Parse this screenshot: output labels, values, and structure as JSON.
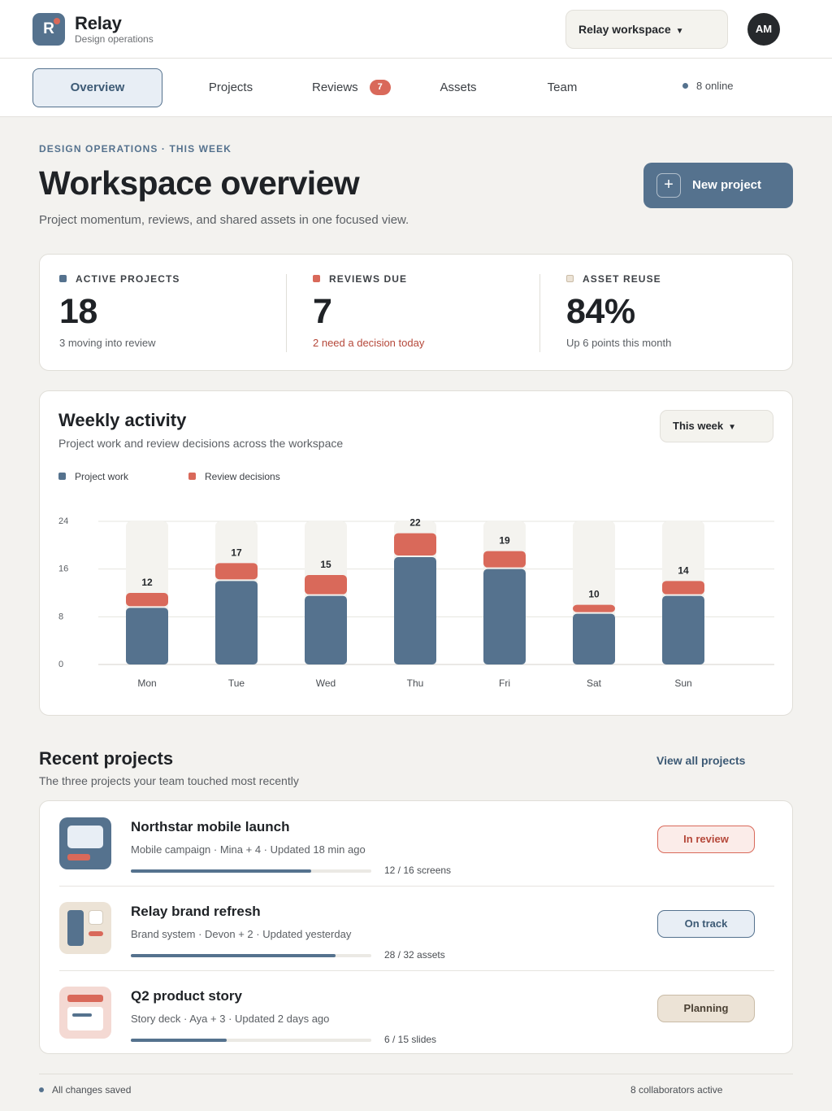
{
  "brand": {
    "name": "Relay",
    "subtitle": "Design operations",
    "logo_letter": "R"
  },
  "workspace_switcher": {
    "label": "Relay workspace",
    "caret": "▼"
  },
  "user": {
    "initials": "AM"
  },
  "nav": {
    "tabs": [
      {
        "label": "Overview",
        "active": true
      },
      {
        "label": "Projects"
      },
      {
        "label": "Reviews",
        "badge": "7"
      },
      {
        "label": "Assets"
      },
      {
        "label": "Team"
      }
    ],
    "online": "8 online"
  },
  "header": {
    "eyebrow": "DESIGN OPERATIONS · THIS WEEK",
    "title": "Workspace overview",
    "subtitle": "Project momentum, reviews, and shared assets in one focused view.",
    "new_button": {
      "icon": "+",
      "label": "New project"
    }
  },
  "stats": [
    {
      "label": "ACTIVE PROJECTS",
      "value": "18",
      "note": "3 moving into review",
      "color": "#55728e"
    },
    {
      "label": "REVIEWS DUE",
      "value": "7",
      "note": "2 need a decision today",
      "color": "#d9695a",
      "note_color": "#b5483a"
    },
    {
      "label": "ASSET REUSE",
      "value": "84%",
      "note": "Up 6 points this month",
      "color": "#ece3d6"
    }
  ],
  "activity": {
    "title": "Weekly activity",
    "subtitle": "Project work and review decisions across the workspace",
    "range_button": "This week",
    "range_caret": "▼"
  },
  "chart_data": {
    "type": "bar",
    "stacked": true,
    "categories": [
      "Mon",
      "Tue",
      "Wed",
      "Thu",
      "Fri",
      "Sat",
      "Sun"
    ],
    "series": [
      {
        "name": "Project work",
        "color": "#55728e",
        "values": [
          9.5,
          14,
          11.5,
          18,
          16,
          8.5,
          11.5
        ]
      },
      {
        "name": "Review decisions",
        "color": "#d9695a",
        "values": [
          2.5,
          3,
          3.5,
          4,
          3,
          1.5,
          2.5
        ]
      }
    ],
    "totals": [
      12,
      17,
      15,
      22,
      19,
      10,
      14
    ],
    "yticks": [
      "0",
      "8",
      "16",
      "24"
    ],
    "ylim": [
      0,
      24
    ],
    "grid": true,
    "legend": "top-left"
  },
  "recent": {
    "title": "Recent projects",
    "subtitle": "The three projects your team touched most recently",
    "view_all": "View all projects",
    "projects": [
      {
        "name": "Northstar mobile launch",
        "meta": "Mobile campaign · Mina + 4 · Updated 18 min ago",
        "progress_label": "12 / 16 screens",
        "progress": 0.75,
        "status": "In review"
      },
      {
        "name": "Relay brand refresh",
        "meta": "Brand system · Devon + 2 · Updated yesterday",
        "progress_label": "28 / 32 assets",
        "progress": 0.85,
        "status": "On track"
      },
      {
        "name": "Q2 product story",
        "meta": "Story deck · Aya + 3 · Updated 2 days ago",
        "progress_label": "6 / 15 slides",
        "progress": 0.4,
        "status": "Planning"
      }
    ]
  },
  "footer": {
    "saved": "All changes saved",
    "collaborators": "8 collaborators active"
  }
}
